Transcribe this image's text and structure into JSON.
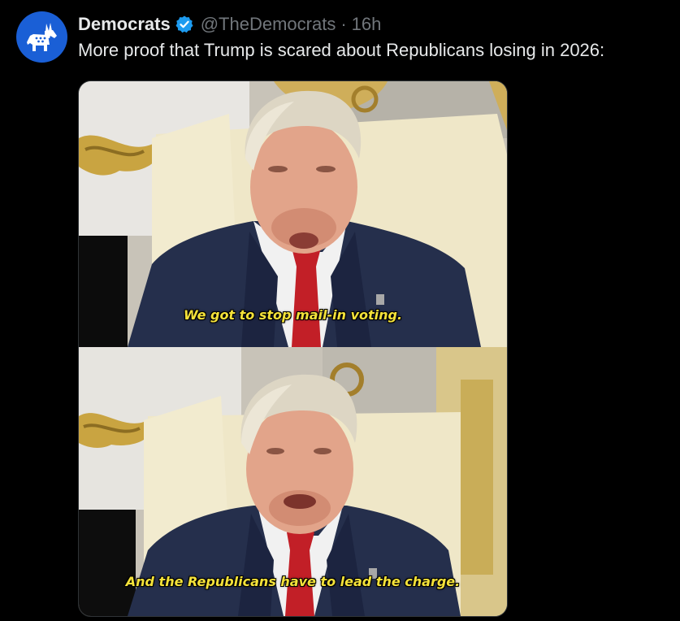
{
  "tweet": {
    "display_name": "Democrats",
    "handle": "@TheDemocrats",
    "separator": "·",
    "time": "16h",
    "text": "More proof that Trump is scared about Republicans losing in 2026:",
    "verified": true,
    "avatar_icon": "donkey-logo-icon",
    "avatar_color": "#1a5fd6",
    "verified_color": "#1d9bf0"
  },
  "media": {
    "frames": [
      {
        "caption": "We got to stop mail-in voting."
      },
      {
        "caption": "And the Republicans have to lead the charge."
      }
    ]
  }
}
